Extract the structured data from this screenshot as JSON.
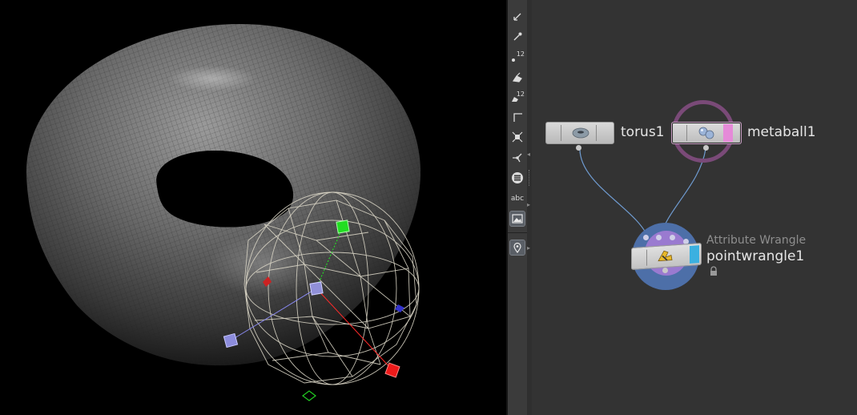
{
  "toolbar": {
    "tools": [
      {
        "name": "select-tool-icon"
      },
      {
        "name": "brush-tool-icon"
      },
      {
        "name": "point-numbers-icon",
        "text": "12"
      },
      {
        "name": "paint-tool-icon"
      },
      {
        "name": "prim-numbers-icon",
        "text": "12"
      },
      {
        "name": "corner-tool-icon"
      },
      {
        "name": "snap-tool-icon"
      },
      {
        "name": "handle-tool-icon"
      },
      {
        "name": "display-options-icon"
      },
      {
        "name": "text-tool-icon",
        "text": "abc"
      },
      {
        "name": "background-image-icon"
      },
      {
        "name": "pin-tool-icon"
      }
    ]
  },
  "network": {
    "nodes": {
      "torus": {
        "label": "torus1"
      },
      "metaball": {
        "label": "metaball1"
      },
      "wrangle": {
        "label": "pointwrangle1",
        "type": "Attribute Wrangle"
      }
    }
  },
  "colors": {
    "network_bg": "#333333",
    "toolbar_bg": "#3b3b3b",
    "wire": "#6f9bd0",
    "metaball_ring": "#7a4a78",
    "metaball_flag": "#e58ad8",
    "wrangle_ring": "#4d6fa8",
    "wrangle_inner": "#9a7ad0",
    "wrangle_flag": "#3bb0e0",
    "handle_x": "#ff2a2a",
    "handle_y": "#22ee22",
    "handle_z": "#8888ee"
  }
}
